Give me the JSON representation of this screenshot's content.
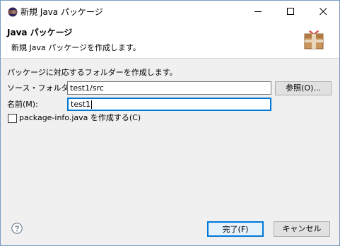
{
  "window": {
    "title": "新規 Java パッケージ",
    "controls": {
      "minimize": "minimize-icon",
      "maximize": "maximize-icon",
      "close": "close-icon"
    }
  },
  "header": {
    "title": "Java パッケージ",
    "message": "新規 Java パッケージを作成します。",
    "icon": "package-icon"
  },
  "body": {
    "description": "パッケージに対応するフォルダーを作成します。",
    "source_folder_label": "ソース・フォルダー(D):",
    "source_folder_value": "test1/src",
    "browse_button": "参照(O)...",
    "name_label": "名前(M):",
    "name_value": "test1",
    "checkbox_label": "package-info.java を作成する(C)",
    "checkbox_checked": false
  },
  "footer": {
    "help_icon": "help-icon",
    "finish_button": "完了(F)",
    "cancel_button": "キャンセル"
  },
  "colors": {
    "accent": "#0078d7",
    "dialog_bg": "#f0f0f0",
    "header_bg": "#ffffff"
  }
}
